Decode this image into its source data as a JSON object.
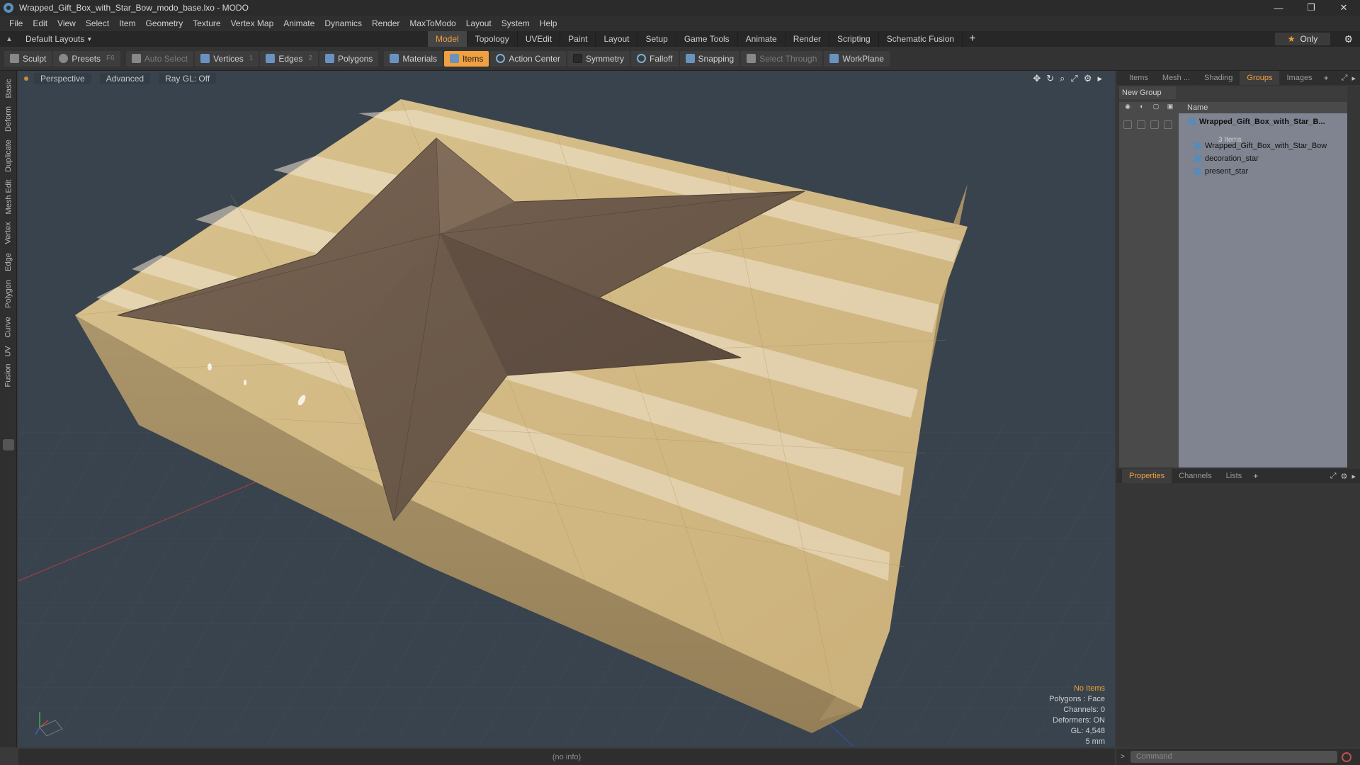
{
  "window": {
    "title": "Wrapped_Gift_Box_with_Star_Bow_modo_base.lxo - MODO",
    "minimize": "—",
    "maximize": "❐",
    "close": "✕"
  },
  "menu": [
    "File",
    "Edit",
    "View",
    "Select",
    "Item",
    "Geometry",
    "Texture",
    "Vertex Map",
    "Animate",
    "Dynamics",
    "Render",
    "MaxToModo",
    "Layout",
    "System",
    "Help"
  ],
  "layout": {
    "selector": "Default Layouts",
    "only_label": "Only",
    "mode_tabs": [
      "Model",
      "Topology",
      "UVEdit",
      "Paint",
      "Layout",
      "Setup",
      "Game Tools",
      "Animate",
      "Render",
      "Scripting",
      "Schematic Fusion"
    ],
    "active_tab": "Model"
  },
  "toolbar": {
    "sculpt": "Sculpt",
    "presets": "Presets",
    "presets_key": "F6",
    "auto_select": "Auto Select",
    "vertices": "Vertices",
    "vertices_key": "1",
    "edges": "Edges",
    "edges_key": "2",
    "polygons": "Polygons",
    "materials": "Materials",
    "items": "Items",
    "action_center": "Action Center",
    "symmetry": "Symmetry",
    "falloff": "Falloff",
    "snapping": "Snapping",
    "select_through": "Select Through",
    "workplane": "WorkPlane"
  },
  "left_tabs": [
    "Basic",
    "Deform",
    "Duplicate",
    "Mesh Edit",
    "Vertex",
    "Edge",
    "Polygon",
    "Curve",
    "UV",
    "Fusion"
  ],
  "viewport": {
    "view": "Perspective",
    "shading": "Advanced",
    "raygl": "Ray GL: Off",
    "hud": {
      "no_items": "No Items",
      "polygons": "Polygons : Face",
      "channels": "Channels: 0",
      "deformers": "Deformers: ON",
      "gl": "GL: 4,548",
      "unit": "5 mm"
    }
  },
  "status": "(no info)",
  "groups_panel": {
    "tabs": [
      "Items",
      "Mesh ...",
      "Shading",
      "Groups",
      "Images"
    ],
    "active_tab": "Groups",
    "new_group": "New Group",
    "column_name": "Name",
    "tree": {
      "root": "Wrapped_Gift_Box_with_Star_B...",
      "root_count": "3 Items",
      "children": [
        "Wrapped_Gift_Box_with_Star_Bow",
        "decoration_star",
        "present_star"
      ]
    }
  },
  "props_panel": {
    "tabs": [
      "Properties",
      "Channels",
      "Lists"
    ],
    "active_tab": "Properties"
  },
  "command": {
    "placeholder": "Command"
  },
  "colors": {
    "accent": "#f0a040",
    "box": "#d9c08a",
    "star": "#6e5a4c",
    "viewport_bg": "#39434d"
  }
}
